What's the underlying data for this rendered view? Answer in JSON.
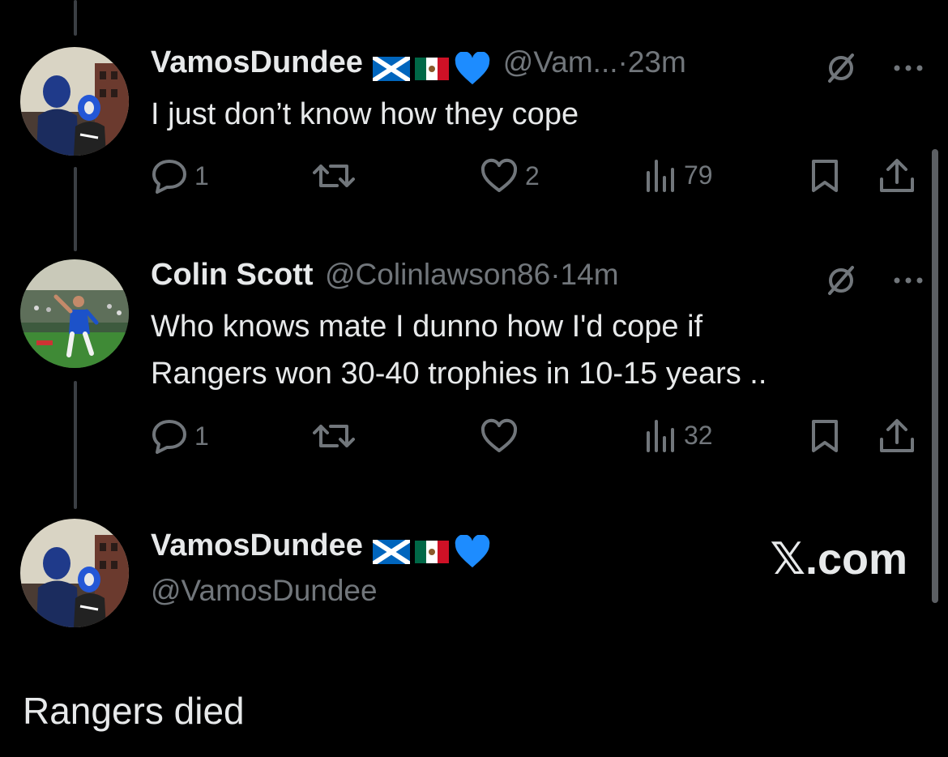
{
  "tweets": [
    {
      "name": "VamosDundee",
      "handle": "@Vam...",
      "time": "23m",
      "text": "I just don’t know how they cope",
      "replies": "1",
      "retweets": "",
      "likes": "2",
      "views": "79"
    },
    {
      "name": "Colin Scott",
      "handle": "@Colinlawson86",
      "time": "14m",
      "text_line1": "Who knows mate I dunno how I'd cope if",
      "text_line2": "Rangers won 30-40 trophies in 10-15 years ..",
      "replies": "1",
      "retweets": "",
      "likes": "",
      "views": "32"
    }
  ],
  "main_tweet": {
    "name": "VamosDundee",
    "handle": "@VamosDundee",
    "text": "Rangers died"
  },
  "brand": {
    "label": "𝕏.com"
  },
  "separator": "·",
  "icons": [
    "reply-icon",
    "retweet-icon",
    "like-icon",
    "views-icon",
    "bookmark-icon",
    "share-icon",
    "grok-icon",
    "more-icon",
    "scotland-flag-icon",
    "mexico-flag-icon",
    "blue-heart-icon"
  ],
  "colors": {
    "background": "#000000",
    "text": "#e7e9ea",
    "secondary": "#71767b",
    "thread_line": "#3b3f44",
    "heart": "#1d9bf0"
  }
}
